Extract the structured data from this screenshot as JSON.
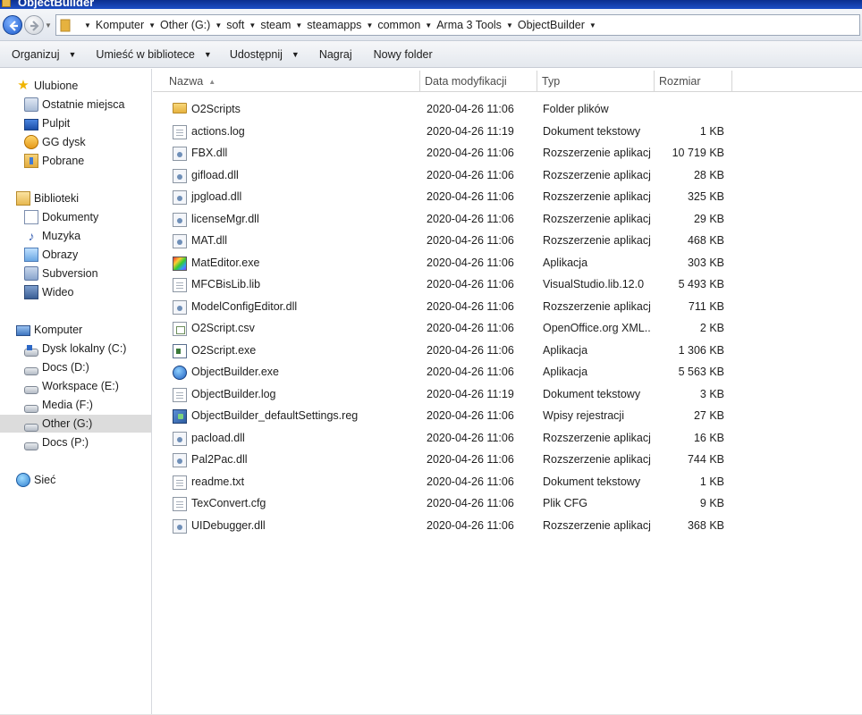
{
  "window": {
    "title": "ObjectBuilder"
  },
  "address": {
    "breadcrumbs": [
      "Komputer",
      "Other (G:)",
      "soft",
      "steam",
      "steamapps",
      "common",
      "Arma 3 Tools",
      "ObjectBuilder"
    ]
  },
  "toolbar": {
    "organize_label": "Organizuj",
    "library_label": "Umieść w bibliotece",
    "share_label": "Udostępnij",
    "burn_label": "Nagraj",
    "new_folder_label": "Nowy folder"
  },
  "nav": {
    "favorites_label": "Ulubione",
    "favorites": [
      "Ostatnie miejsca",
      "Pulpit",
      "GG dysk",
      "Pobrane"
    ],
    "libraries_label": "Biblioteki",
    "libraries": [
      "Dokumenty",
      "Muzyka",
      "Obrazy",
      "Subversion",
      "Wideo"
    ],
    "computer_label": "Komputer",
    "drives": [
      "Dysk lokalny (C:)",
      "Docs (D:)",
      "Workspace (E:)",
      "Media (F:)",
      "Other (G:)",
      "Docs (P:)"
    ],
    "network_label": "Sieć"
  },
  "columns": {
    "name": "Nazwa",
    "date": "Data modyfikacji",
    "type": "Typ",
    "size": "Rozmiar"
  },
  "files": [
    {
      "name": "O2Scripts",
      "date": "2020-04-26 11:06",
      "type": "Folder plików",
      "size": "",
      "icon": "folder-icon"
    },
    {
      "name": "actions.log",
      "date": "2020-04-26 11:19",
      "type": "Dokument tekstowy",
      "size": "1 KB",
      "icon": "text-file-icon"
    },
    {
      "name": "FBX.dll",
      "date": "2020-04-26 11:06",
      "type": "Rozszerzenie aplikacji",
      "size": "10 719 KB",
      "icon": "dll-icon"
    },
    {
      "name": "gifload.dll",
      "date": "2020-04-26 11:06",
      "type": "Rozszerzenie aplikacji",
      "size": "28 KB",
      "icon": "dll-icon"
    },
    {
      "name": "jpgload.dll",
      "date": "2020-04-26 11:06",
      "type": "Rozszerzenie aplikacji",
      "size": "325 KB",
      "icon": "dll-icon"
    },
    {
      "name": "licenseMgr.dll",
      "date": "2020-04-26 11:06",
      "type": "Rozszerzenie aplikacji",
      "size": "29 KB",
      "icon": "dll-icon"
    },
    {
      "name": "MAT.dll",
      "date": "2020-04-26 11:06",
      "type": "Rozszerzenie aplikacji",
      "size": "468 KB",
      "icon": "dll-icon"
    },
    {
      "name": "MatEditor.exe",
      "date": "2020-04-26 11:06",
      "type": "Aplikacja",
      "size": "303 KB",
      "icon": "mateditor-app-icon"
    },
    {
      "name": "MFCBisLib.lib",
      "date": "2020-04-26 11:06",
      "type": "VisualStudio.lib.12.0",
      "size": "5 493 KB",
      "icon": "blank-file-icon"
    },
    {
      "name": "ModelConfigEditor.dll",
      "date": "2020-04-26 11:06",
      "type": "Rozszerzenie aplikacji",
      "size": "711 KB",
      "icon": "dll-icon"
    },
    {
      "name": "O2Script.csv",
      "date": "2020-04-26 11:06",
      "type": "OpenOffice.org XML...",
      "size": "2 KB",
      "icon": "csv-file-icon"
    },
    {
      "name": "O2Script.exe",
      "date": "2020-04-26 11:06",
      "type": "Aplikacja",
      "size": "1 306 KB",
      "icon": "o2script-app-icon"
    },
    {
      "name": "ObjectBuilder.exe",
      "date": "2020-04-26 11:06",
      "type": "Aplikacja",
      "size": "5 563 KB",
      "icon": "objectbuilder-app-icon"
    },
    {
      "name": "ObjectBuilder.log",
      "date": "2020-04-26 11:19",
      "type": "Dokument tekstowy",
      "size": "3 KB",
      "icon": "text-file-icon"
    },
    {
      "name": "ObjectBuilder_defaultSettings.reg",
      "date": "2020-04-26 11:06",
      "type": "Wpisy rejestracji",
      "size": "27 KB",
      "icon": "registry-file-icon"
    },
    {
      "name": "pacload.dll",
      "date": "2020-04-26 11:06",
      "type": "Rozszerzenie aplikacji",
      "size": "16 KB",
      "icon": "dll-icon"
    },
    {
      "name": "Pal2Pac.dll",
      "date": "2020-04-26 11:06",
      "type": "Rozszerzenie aplikacji",
      "size": "744 KB",
      "icon": "dll-icon"
    },
    {
      "name": "readme.txt",
      "date": "2020-04-26 11:06",
      "type": "Dokument tekstowy",
      "size": "1 KB",
      "icon": "text-file-icon"
    },
    {
      "name": "TexConvert.cfg",
      "date": "2020-04-26 11:06",
      "type": "Plik CFG",
      "size": "9 KB",
      "icon": "text-file-icon"
    },
    {
      "name": "UIDebugger.dll",
      "date": "2020-04-26 11:06",
      "type": "Rozszerzenie aplikacji",
      "size": "368 KB",
      "icon": "dll-icon"
    }
  ],
  "colors": {
    "titlebar": "#1d4fc5",
    "selection": "#dcdcdc",
    "folder": "#e6b23f"
  }
}
